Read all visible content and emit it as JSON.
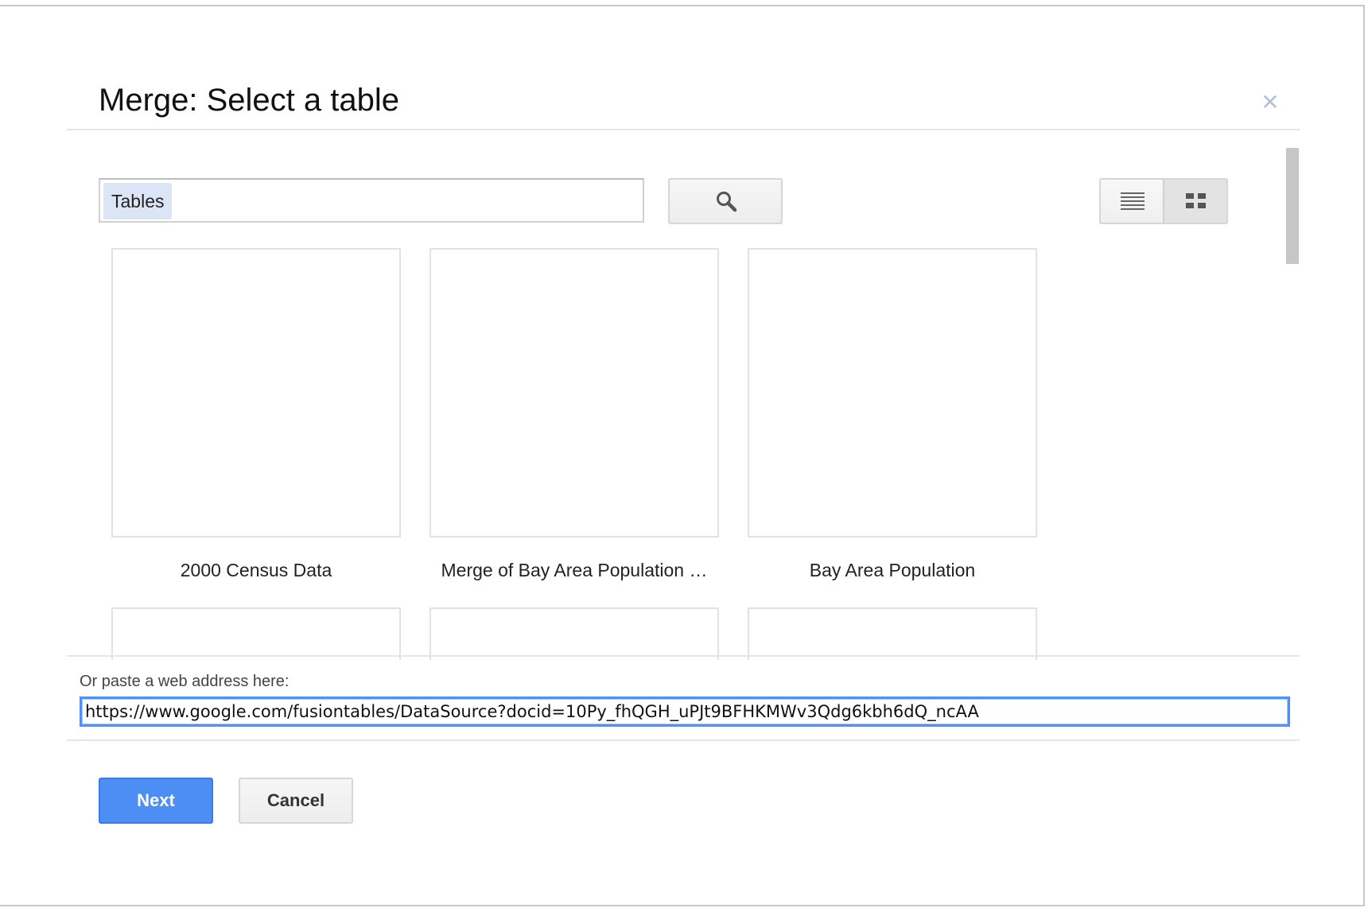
{
  "dialog": {
    "title": "Merge: Select a table",
    "close_icon": "close-icon"
  },
  "search": {
    "chip_label": "Tables",
    "button_icon": "search-icon"
  },
  "view_toggle": {
    "options": [
      {
        "icon": "list-view-icon",
        "active": false
      },
      {
        "icon": "grid-view-icon",
        "active": true
      }
    ]
  },
  "tables": [
    {
      "label": "2000 Census Data"
    },
    {
      "label": "Merge of Bay Area Population …"
    },
    {
      "label": "Bay Area Population"
    },
    {
      "label": ""
    },
    {
      "label": ""
    },
    {
      "label": ""
    }
  ],
  "url_section": {
    "label": "Or paste a web address here:",
    "value": "https://www.google.com/fusiontables/DataSource?docid=10Py_fhQGH_uPJt9BFHKMWv3Qdg6kbh6dQ_ncAA"
  },
  "actions": {
    "next_label": "Next",
    "cancel_label": "Cancel"
  },
  "colors": {
    "accent": "#4d8ef5",
    "focus_border": "#4d90fe",
    "chip_bg": "#dbe5f5"
  }
}
